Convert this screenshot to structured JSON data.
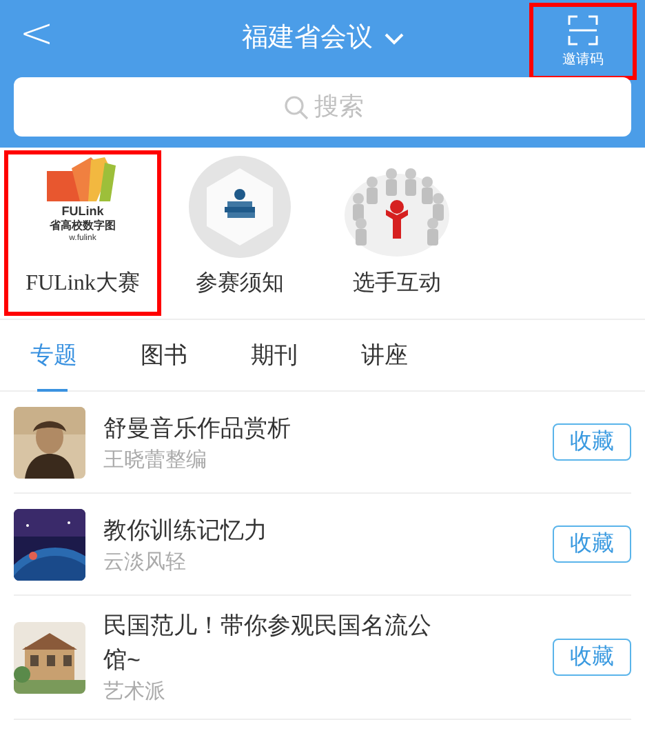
{
  "header": {
    "back": "<",
    "title": "福建省会议",
    "invite": {
      "label": "邀请码",
      "highlighted": true
    }
  },
  "search": {
    "placeholder": "搜索"
  },
  "shortcuts": [
    {
      "kind": "logo",
      "label": "FULink大赛",
      "highlighted": true,
      "logo_text": [
        "FULink",
        "省高校数字图",
        "w.fulink"
      ]
    },
    {
      "kind": "books",
      "label": "参赛须知",
      "highlighted": false
    },
    {
      "kind": "people",
      "label": "选手互动",
      "highlighted": false
    }
  ],
  "tabs": [
    {
      "label": "专题",
      "selected": true
    },
    {
      "label": "图书",
      "selected": false
    },
    {
      "label": "期刊",
      "selected": false
    },
    {
      "label": "讲座",
      "selected": false
    }
  ],
  "items": [
    {
      "title": "舒曼音乐作品赏析",
      "author": "王晓蕾整编",
      "button": "收藏"
    },
    {
      "title": "教你训练记忆力",
      "author": "云淡风轻",
      "button": "收藏"
    },
    {
      "title": "民国范儿！带你参观民国名流公馆~",
      "author": "艺术派",
      "button": "收藏"
    }
  ]
}
